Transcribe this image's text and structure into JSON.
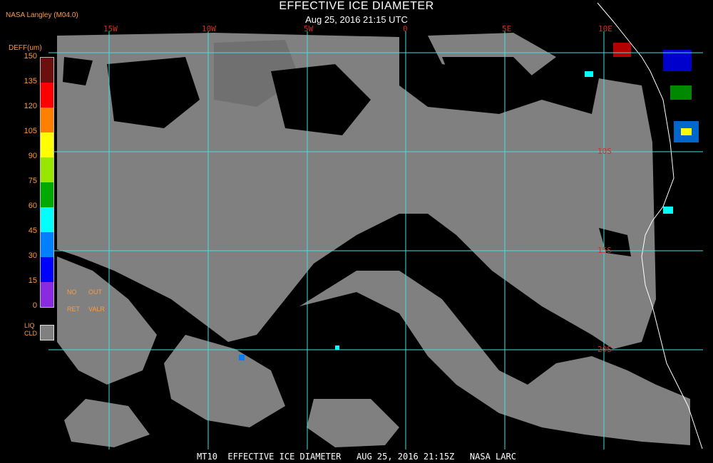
{
  "header": {
    "title": "EFFECTIVE ICE DIAMETER",
    "subtitle": "Aug 25, 2016 21:15 UTC",
    "source": "NASA Langley (M04.0)"
  },
  "legend": {
    "units": "DEFF(um)",
    "ticks": [
      "150",
      "135",
      "120",
      "105",
      "90",
      "75",
      "60",
      "45",
      "30",
      "15",
      "0"
    ],
    "colors": [
      "#6b0f0f",
      "#ff0000",
      "#ff7f00",
      "#ffff00",
      "#99e600",
      "#00aa00",
      "#00ffff",
      "#0080ff",
      "#0000ff",
      "#8a2be2"
    ],
    "no_ret_top": "NO",
    "no_ret_bottom": "RET",
    "out_valr_top": "OUT",
    "out_valr_bottom": "VALR",
    "liq_top": "LIQ",
    "liq_bottom": "CLD",
    "liq_color": "#808080"
  },
  "grid": {
    "lon_labels": [
      "15W",
      "10W",
      "5W",
      "0",
      "5E",
      "10E"
    ],
    "lat_labels": [
      "10S",
      "15S",
      "20S"
    ],
    "line_color": "#40e0e0"
  },
  "footer": {
    "text": "MT10  EFFECTIVE ICE DIAMETER   AUG 25, 2016 21:15Z   NASA LARC"
  }
}
